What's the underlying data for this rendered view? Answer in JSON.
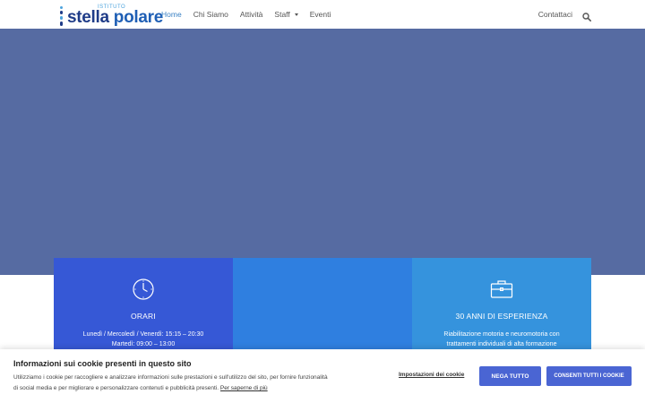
{
  "logo": {
    "small": "ISTITUTO",
    "main_1": "stella",
    "main_2": "polare"
  },
  "nav": {
    "items": [
      {
        "label": "Home",
        "active": true
      },
      {
        "label": "Chi Siamo"
      },
      {
        "label": "Attività"
      },
      {
        "label": "Staff",
        "dropdown": true
      },
      {
        "label": "Eventi"
      }
    ],
    "contact": "Contattaci",
    "search_icon": "search-icon"
  },
  "colors": {
    "hero": "#566ba2",
    "feature1": "#3658d6",
    "feature2": "#2f7fe0",
    "feature3": "#3593dd",
    "button": "#4a65d3"
  },
  "features": [
    {
      "icon": "clock-icon",
      "title": "ORARI",
      "line1": "Lunedì / Mercoledì / Venerdì: 15:15 – 20:30",
      "line2": "Martedì: 09:00 – 13:00"
    },
    {
      "icon": "",
      "title": "",
      "line1": "",
      "line2": ""
    },
    {
      "icon": "briefcase-icon",
      "title": "30 ANNI DI ESPERIENZA",
      "line1": "Riabilitazione motoria e neuromotoria con",
      "line2": "trattamenti individuali di alta formazione"
    }
  ],
  "cookie": {
    "title": "Informazioni sui cookie presenti in questo sito",
    "text_1": "Utilizziamo i cookie per raccogliere e analizzare informazioni sulle prestazioni e sull'utilizzo del sito, per fornire funzionalità",
    "text_2": "di social media e per migliorare e personalizzare contenuti e pubblicità presenti.",
    "link": "Per saperne di più",
    "settings": "Impostazioni dei cookie",
    "deny": "NEGA TUTTO",
    "accept": "CONSENTI TUTTI I COOKIE"
  }
}
